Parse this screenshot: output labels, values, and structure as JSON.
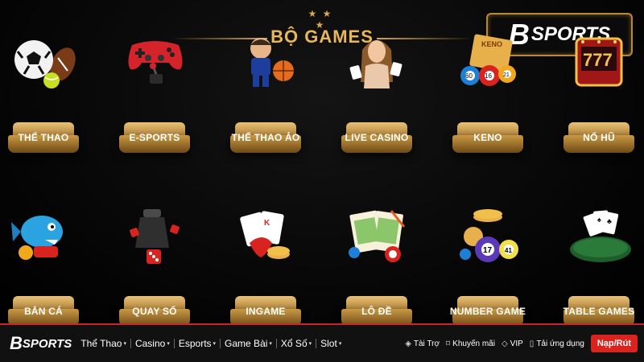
{
  "header": {
    "stars": "★ ★ ★",
    "title": "BỘ GAMES",
    "brand_mark": "B",
    "brand_text": "SPORTS"
  },
  "games_row1": [
    {
      "label": "THỂ THAO",
      "icon": "soccer-ball-icon"
    },
    {
      "label": "E-SPORTS",
      "icon": "gamepad-icon"
    },
    {
      "label": "THỂ THAO ẢO",
      "icon": "virtual-sports-icon"
    },
    {
      "label": "LIVE CASINO",
      "icon": "live-dealer-icon"
    },
    {
      "label": "KENO",
      "icon": "keno-balls-icon"
    },
    {
      "label": "NỔ HŨ",
      "icon": "slot-machine-icon"
    }
  ],
  "games_row2": [
    {
      "label": "BẮN CÁ",
      "icon": "fish-shooter-icon"
    },
    {
      "label": "QUAY SỐ",
      "icon": "dice-cup-icon"
    },
    {
      "label": "INGAME",
      "icon": "cards-chips-icon"
    },
    {
      "label": "LÔ ĐỀ",
      "icon": "lottery-ticket-icon"
    },
    {
      "label": "NUMBER GAME",
      "icon": "number-balls-icon"
    },
    {
      "label": "TABLE GAMES",
      "icon": "card-table-icon"
    }
  ],
  "keno_balls": [
    "KENO",
    "60",
    "16",
    "21"
  ],
  "number_balls": [
    "17",
    "41"
  ],
  "nav": {
    "logo_mark": "B",
    "logo_text": "SPORTS",
    "menu": [
      {
        "label": "Thể Thao",
        "caret": "▾"
      },
      {
        "label": "Casino",
        "caret": "▾"
      },
      {
        "label": "Esports",
        "caret": "▾"
      },
      {
        "label": "Game Bài",
        "caret": "▾"
      },
      {
        "label": "Xổ Số",
        "caret": "▾"
      },
      {
        "label": "Slot",
        "caret": "▾"
      }
    ],
    "utilities": [
      {
        "label": "Tài Trợ",
        "icon": "sponsor-icon"
      },
      {
        "label": "Khuyến mãi",
        "icon": "promo-tag-icon"
      },
      {
        "label": "VIP",
        "icon": "diamond-icon"
      },
      {
        "label": "Tải ứng dụng",
        "icon": "phone-icon"
      }
    ],
    "cta": "Nạp/Rút"
  },
  "colors": {
    "gold": "#e8b75c",
    "red": "#d8231f",
    "background": "#000000"
  }
}
